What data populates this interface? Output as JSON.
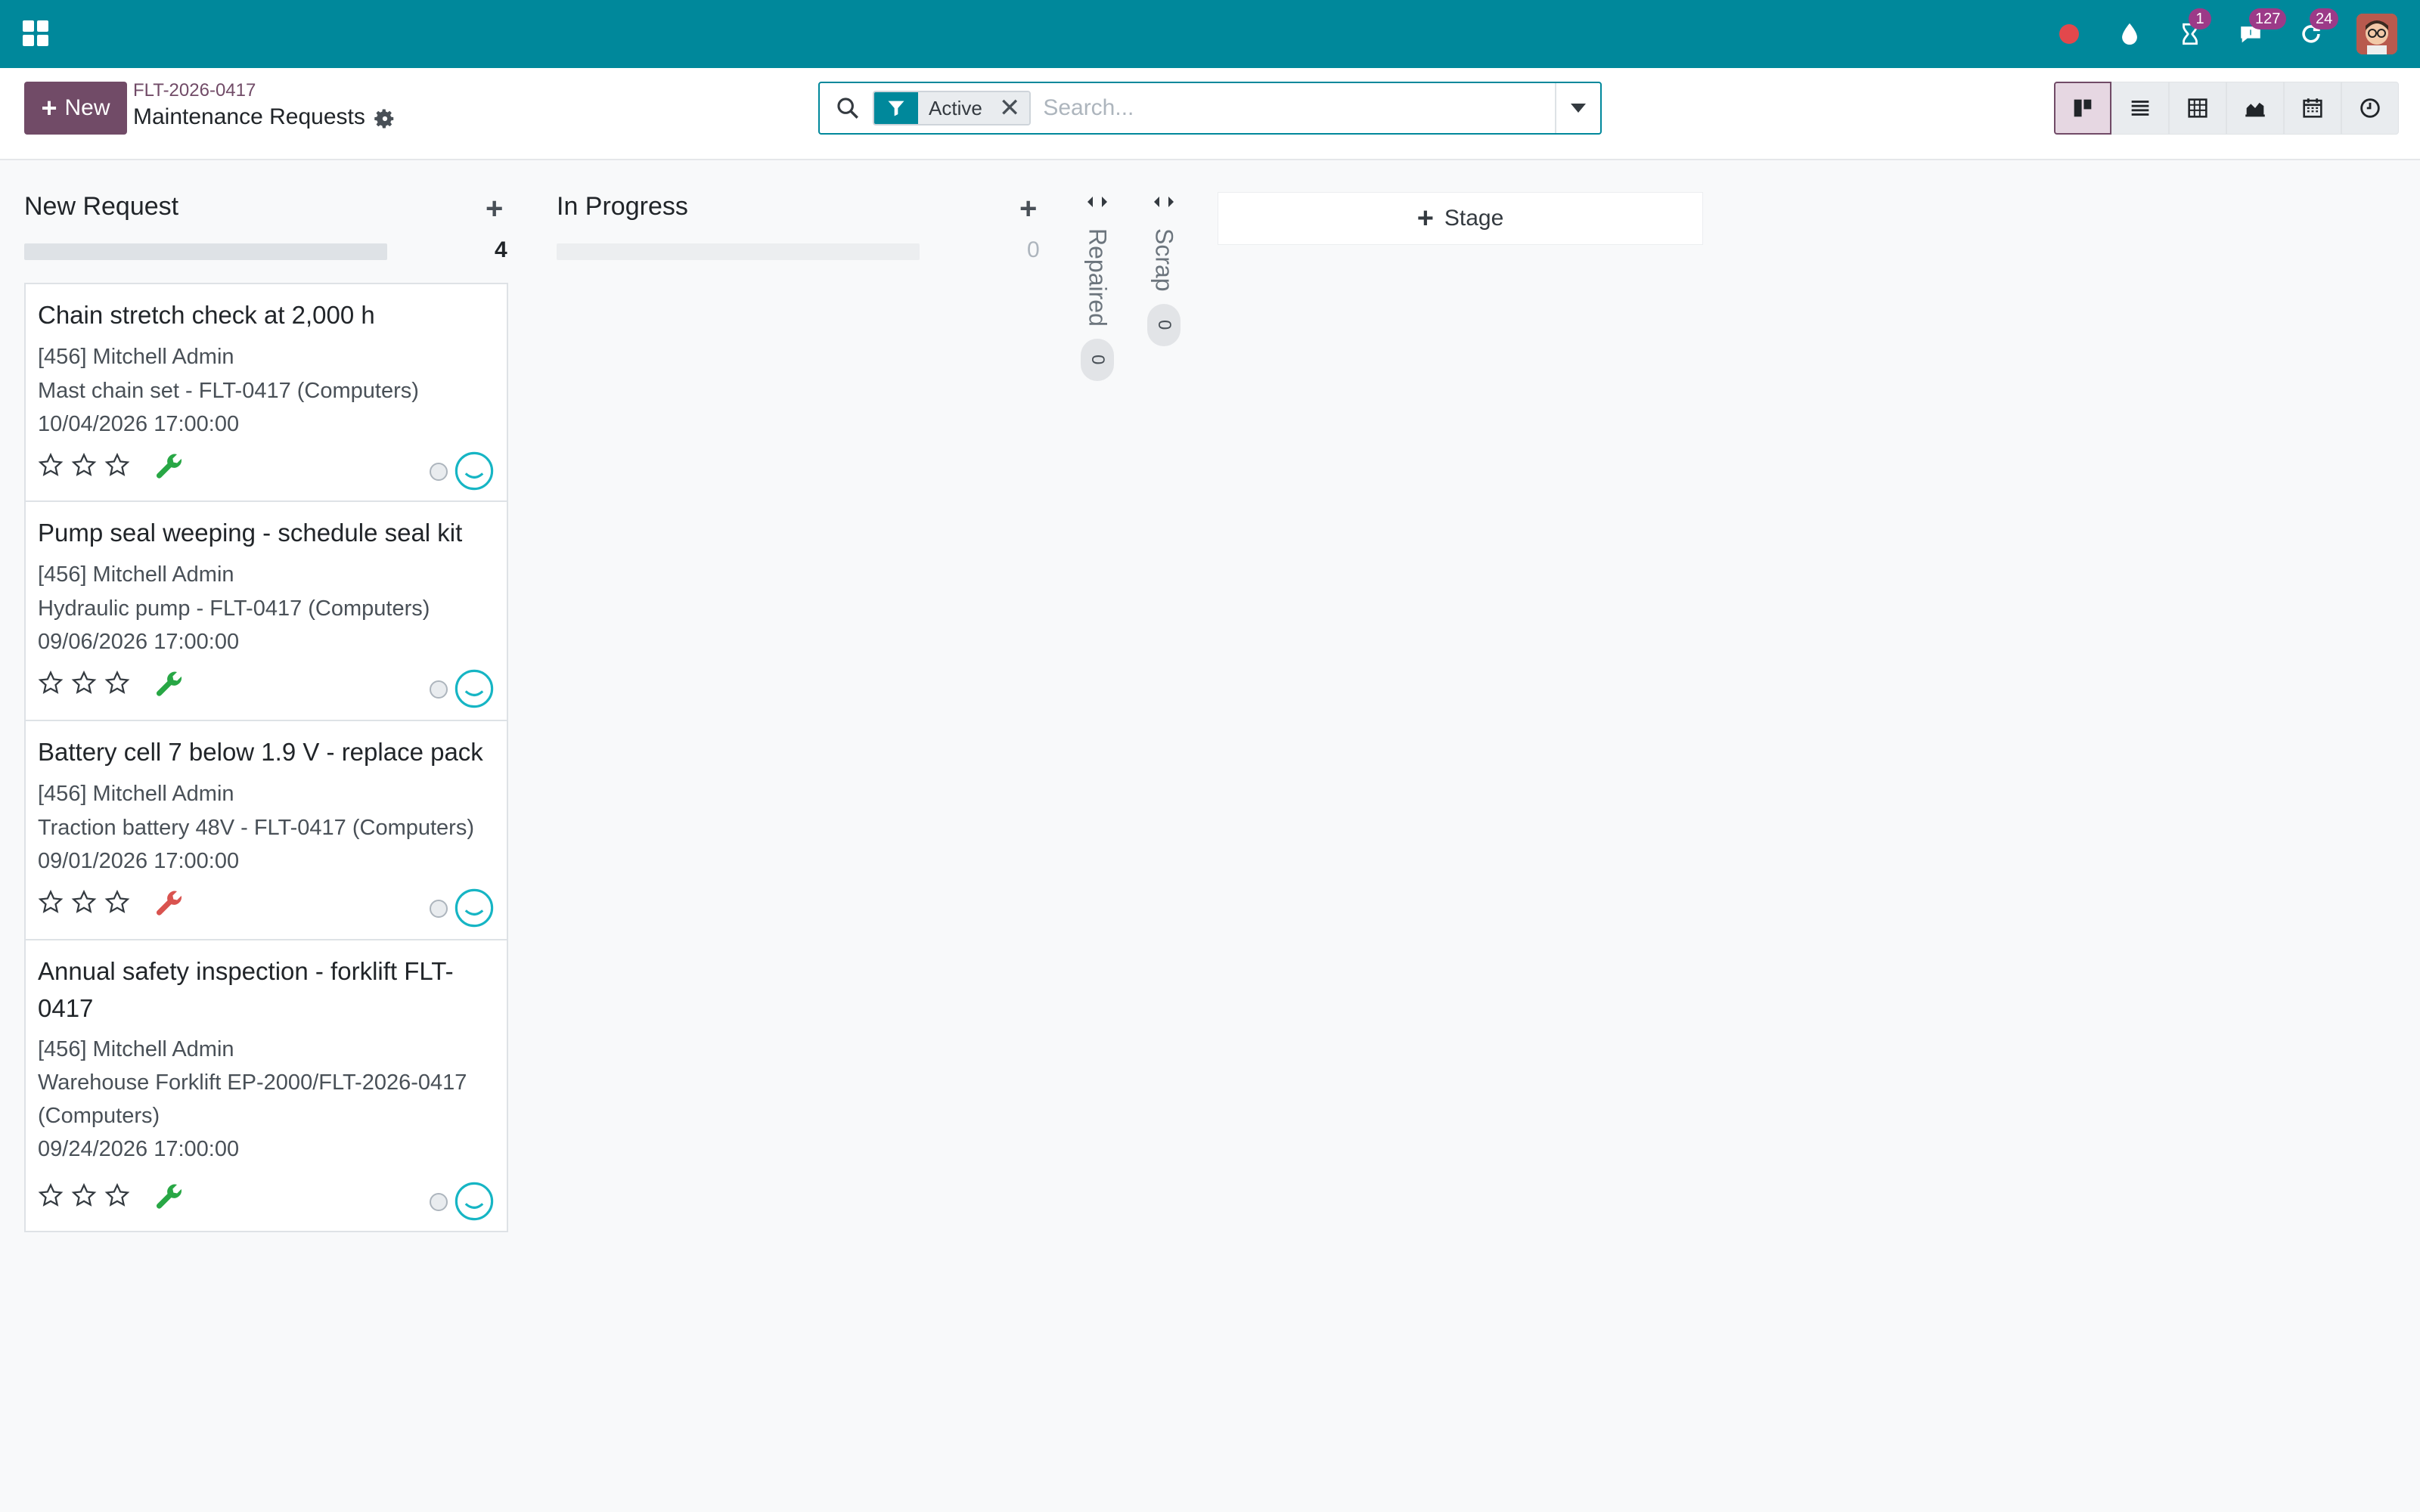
{
  "navbar": {
    "badges": {
      "activities": "1",
      "messages": "127",
      "updates": "24"
    },
    "colors": {
      "bar": "#00889b",
      "badge": "#9c3a88",
      "record": "#e2484c"
    }
  },
  "control_panel": {
    "new_label": "New",
    "breadcrumb": "FLT-2026-0417",
    "title": "Maintenance Requests",
    "search": {
      "facet": "Active",
      "placeholder": "Search..."
    },
    "views": [
      "kanban",
      "list",
      "pivot",
      "graph",
      "calendar",
      "activity"
    ],
    "active_view": "kanban",
    "brand_color": "#714b67"
  },
  "kanban": {
    "columns": [
      {
        "title": "New Request",
        "count": "4"
      },
      {
        "title": "In Progress",
        "count": "0"
      }
    ],
    "folded": [
      {
        "title": "Repaired",
        "count": "0"
      },
      {
        "title": "Scrap",
        "count": "0"
      }
    ],
    "add_stage_label": "Stage",
    "cards": [
      {
        "title": "Chain stretch check at 2,000 h",
        "user": "[456] Mitchell Admin",
        "equipment": "Mast chain set - FLT-0417 (Computers)",
        "date": "10/04/2026 17:00:00",
        "priority": 0,
        "wrench_color": "#28a745"
      },
      {
        "title": "Pump seal weeping - schedule seal kit",
        "user": "[456] Mitchell Admin",
        "equipment": "Hydraulic pump - FLT-0417 (Computers)",
        "date": "09/06/2026 17:00:00",
        "priority": 0,
        "wrench_color": "#28a745"
      },
      {
        "title": "Battery cell 7 below 1.9 V - replace pack",
        "user": "[456] Mitchell Admin",
        "equipment": "Traction battery 48V - FLT-0417 (Computers)",
        "date": "09/01/2026 17:00:00",
        "priority": 0,
        "wrench_color": "#d9534f"
      },
      {
        "title": "Annual safety inspection - forklift FLT-0417",
        "user": "[456] Mitchell Admin",
        "equipment": "Warehouse Forklift EP-2000/FLT-2026-0417 (Computers)",
        "date": "09/24/2026 17:00:00",
        "priority": 0,
        "wrench_color": "#28a745"
      }
    ]
  }
}
